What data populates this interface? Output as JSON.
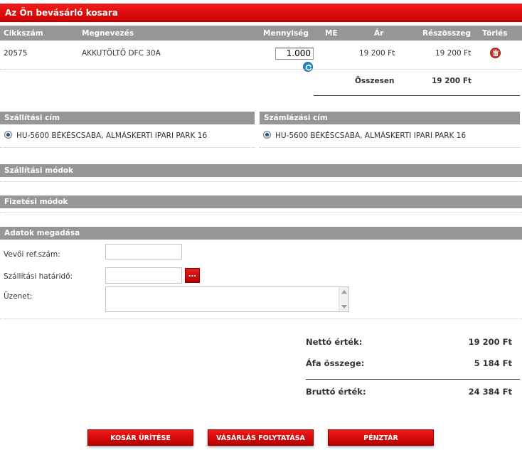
{
  "cart": {
    "title": "Az Ön bevásárló kosara",
    "columns": {
      "sku": "Cikkszám",
      "name": "Megnevezés",
      "qty": "Mennyiség",
      "unit": "ME",
      "price": "Ár",
      "subtotal": "Részösszeg",
      "delete": "Törlés"
    },
    "items": [
      {
        "sku": "20575",
        "name": "AKKUTÖLTŐ DFC 30A",
        "qty": "1.000",
        "unit": "",
        "price": "19 200 Ft",
        "subtotal": "19 200 Ft"
      }
    ],
    "total_label": "Összesen",
    "total_value": "19 200 Ft"
  },
  "shipping_address": {
    "title": "Szállítási cím",
    "value": "HU-5600 BÉKÉSCSABA, ALMÁSKERTI IPARI PARK 16"
  },
  "billing_address": {
    "title": "Számlázási cím",
    "value": "HU-5600 BÉKÉSCSABA, ALMÁSKERTI IPARI PARK 16"
  },
  "shipping_methods": {
    "title": "Szállítási módok"
  },
  "payment_methods": {
    "title": "Fizetési módok"
  },
  "details": {
    "title": "Adatok megadása",
    "ref_label": "Vevői ref.szám:",
    "ref_value": "",
    "deadline_label": "Szállítási határidő:",
    "deadline_value": "",
    "date_button": "...",
    "message_label": "Üzenet:",
    "message_value": ""
  },
  "summary": {
    "net_label": "Nettó érték:",
    "net_value": "19 200 Ft",
    "vat_label": "Áfa összege:",
    "vat_value": "5 184 Ft",
    "gross_label": "Bruttó érték:",
    "gross_value": "24 384 Ft"
  },
  "buttons": {
    "clear": "KOSÁR ÜRÍTÉSE",
    "continue": "VÁSÁRLÁS FOLYTATÁSA",
    "checkout": "PÉNZTÁR"
  },
  "icons": {
    "refresh": "refresh-icon",
    "delete": "trash-icon",
    "radio": "radio-selected"
  },
  "colors": {
    "accent_red": "#d40000",
    "header_gray": "#969696",
    "refresh_blue": "#1e8fc8"
  }
}
